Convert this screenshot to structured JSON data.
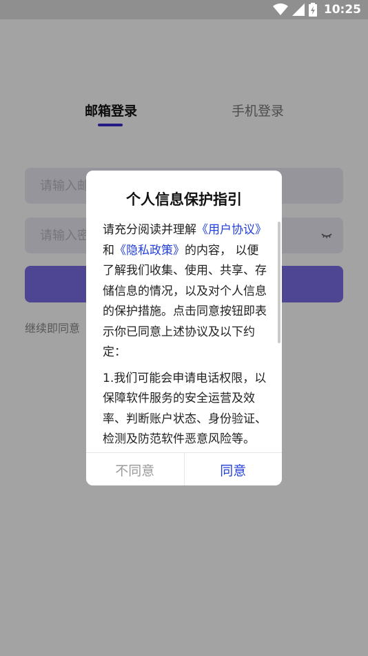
{
  "status_bar": {
    "time": "10:25"
  },
  "login": {
    "tab_email": "邮箱登录",
    "tab_phone": "手机登录",
    "email_placeholder": "请输入邮箱",
    "password_placeholder": "请输入密码",
    "agree_prefix": "继续即同意",
    "accent_color": "#3b2bd0"
  },
  "dialog": {
    "title": "个人信息保护指引",
    "p1_part1": "请充分阅读并理解",
    "user_agreement_link": "《用户协议》",
    "p1_and": "和",
    "privacy_policy_link": "《隐私政策》",
    "p1_part2": "的内容， 以便了解我们收集、使用、共享、存储信息的情况，以及对个人信息的保护措施。点击同意按钮即表示你已同意上述协议及以下约定：",
    "p2": "1.我们可能会申请电话权限，以保障软件服务的安全运营及效率、判断账户状态、身份验证、检测及防范软件恶意风险等。",
    "disagree_label": "不同意",
    "agree_label": "同意",
    "link_color": "#2440d8"
  }
}
